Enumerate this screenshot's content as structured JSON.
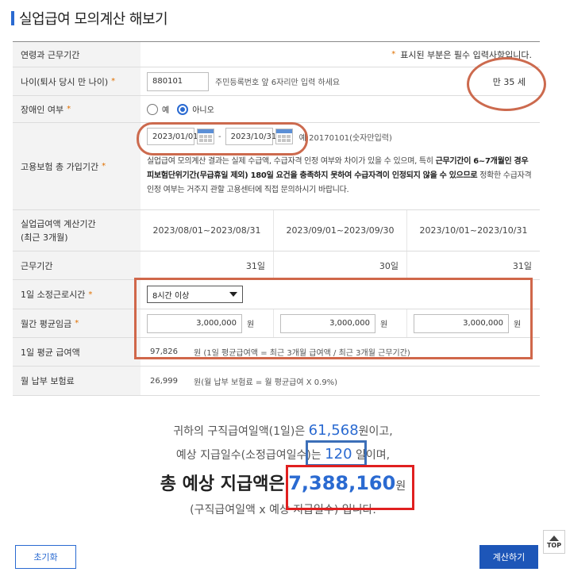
{
  "page_title": "실업급여 모의계산 해보기",
  "form": {
    "header_label": "연령과 근무기간",
    "required_note": "표시된 부분은 필수 입력사항입니다.",
    "required_mark": "*",
    "age": {
      "label": "나이(퇴사 당시 만 나이)",
      "value": "880101",
      "hint": "주민등록번호 앞 6자리만 입력 하세요",
      "computed": "만 35 세"
    },
    "disability": {
      "label": "장애인 여부",
      "options": [
        "예",
        "아니오"
      ],
      "selected": "아니오"
    },
    "employment": {
      "label": "고용보험 총 가입기간",
      "start": "2023/01/01",
      "end": "2023/10/31",
      "dash": "-",
      "example": "예:20170101(숫자만입력)",
      "notice_1": "실업급여 모의계산 결과는 실제 수급액, 수급자격 인정 여부와 차이가 있을 수 있으며, 특히 ",
      "notice_bold": "근무기간이 6~7개월인 경우 피보험단위기간(무급휴일 제외) 180일 요건을 충족하지 못하여 수급자격이 인정되지 않을 수 있으므로",
      "notice_2": " 정확한 수급자격 인정 여부는 거주지 관할 고용센터에 직접 문의하시기 바랍니다."
    },
    "calc_period": {
      "label_line1": "실업급여액 계산기간",
      "label_line2": "(최근 3개월)",
      "periods": [
        "2023/08/01~2023/08/31",
        "2023/09/01~2023/09/30",
        "2023/10/01~2023/10/31"
      ]
    },
    "work_days": {
      "label": "근무기간",
      "values": [
        "31일",
        "30일",
        "31일"
      ]
    },
    "daily_hours": {
      "label": "1일 소정근로시간",
      "selected": "8시간 이상"
    },
    "monthly_wage": {
      "label": "월간 평균임금",
      "values": [
        "3,000,000",
        "3,000,000",
        "3,000,000"
      ],
      "unit": "원"
    },
    "daily_wage": {
      "label": "1일 평균 급여액",
      "value": "97,826",
      "desc": "원 (1일 평균급여액 = 최근 3개월 급여액 / 최근 3개월 근무기간)"
    },
    "premium": {
      "label": "월 납부 보험료",
      "value": "26,999",
      "desc": "원(월 납부 보험료 = 월 평균급여 X 0.9%)"
    }
  },
  "result": {
    "line1_pre": "귀하의 구직급여일액(1일)은 ",
    "daily_amount": "61,568",
    "line1_post": "원이고,",
    "line2_pre": "예상 지급일수(소정급여일수)는 ",
    "days": "120",
    "line2_post": " 일이며,",
    "total_label": "총 예상 지급액은",
    "total_amount": "7,388,160",
    "total_unit": "원",
    "formula": "(구직급여일액 x 예상 지급일수) 입니다."
  },
  "buttons": {
    "reset": "초기화",
    "calculate": "계산하기",
    "top": "TOP"
  },
  "colors": {
    "accent": "#2a6ad1",
    "required": "#e07000",
    "annotation_orange": "#cc6a4e",
    "annotation_red": "#e02020",
    "annotation_blue": "#3c6fb8"
  }
}
